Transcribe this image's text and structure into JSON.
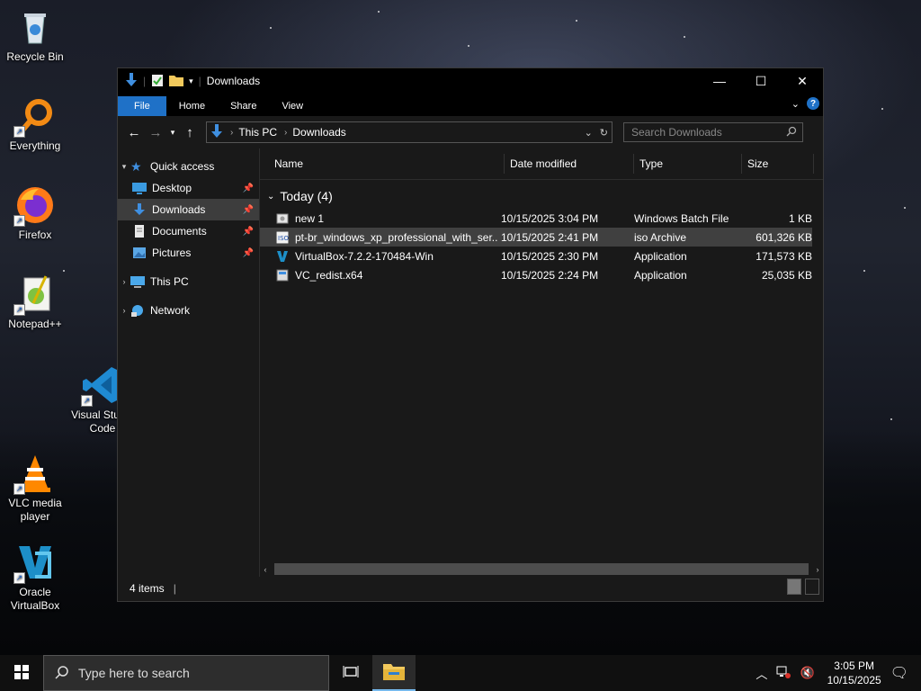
{
  "desktop": {
    "icons": [
      {
        "label": "Recycle Bin"
      },
      {
        "label": "Everything"
      },
      {
        "label": "Firefox"
      },
      {
        "label": "Notepad++"
      },
      {
        "label": "Visual Studio Code"
      },
      {
        "label": "VLC media player"
      },
      {
        "label": "Oracle VirtualBox"
      }
    ]
  },
  "window": {
    "title": "Downloads",
    "ribbon_tabs": [
      "File",
      "Home",
      "Share",
      "View"
    ],
    "help_label": "?",
    "breadcrumb": [
      "This PC",
      "Downloads"
    ],
    "search_placeholder": "Search Downloads",
    "nav": {
      "quick_access": "Quick access",
      "items": [
        "Desktop",
        "Downloads",
        "Documents",
        "Pictures"
      ],
      "this_pc": "This PC",
      "network": "Network"
    },
    "columns": [
      "Name",
      "Date modified",
      "Type",
      "Size"
    ],
    "group_label": "Today (4)",
    "files": [
      {
        "name": "new 1",
        "date": "10/15/2025 3:04 PM",
        "type": "Windows Batch File",
        "size": "1 KB",
        "icon": "batch-file-icon"
      },
      {
        "name": "pt-br_windows_xp_professional_with_ser...",
        "date": "10/15/2025 2:41 PM",
        "type": "iso Archive",
        "size": "601,326 KB",
        "icon": "iso-archive-icon"
      },
      {
        "name": "VirtualBox-7.2.2-170484-Win",
        "date": "10/15/2025 2:30 PM",
        "type": "Application",
        "size": "171,573 KB",
        "icon": "virtualbox-installer-icon"
      },
      {
        "name": "VC_redist.x64",
        "date": "10/15/2025 2:24 PM",
        "type": "Application",
        "size": "25,035 KB",
        "icon": "vc-redist-installer-icon"
      }
    ],
    "status_text": "4 items"
  },
  "taskbar": {
    "search_placeholder": "Type here to search",
    "time": "3:05 PM",
    "date": "10/15/2025"
  }
}
